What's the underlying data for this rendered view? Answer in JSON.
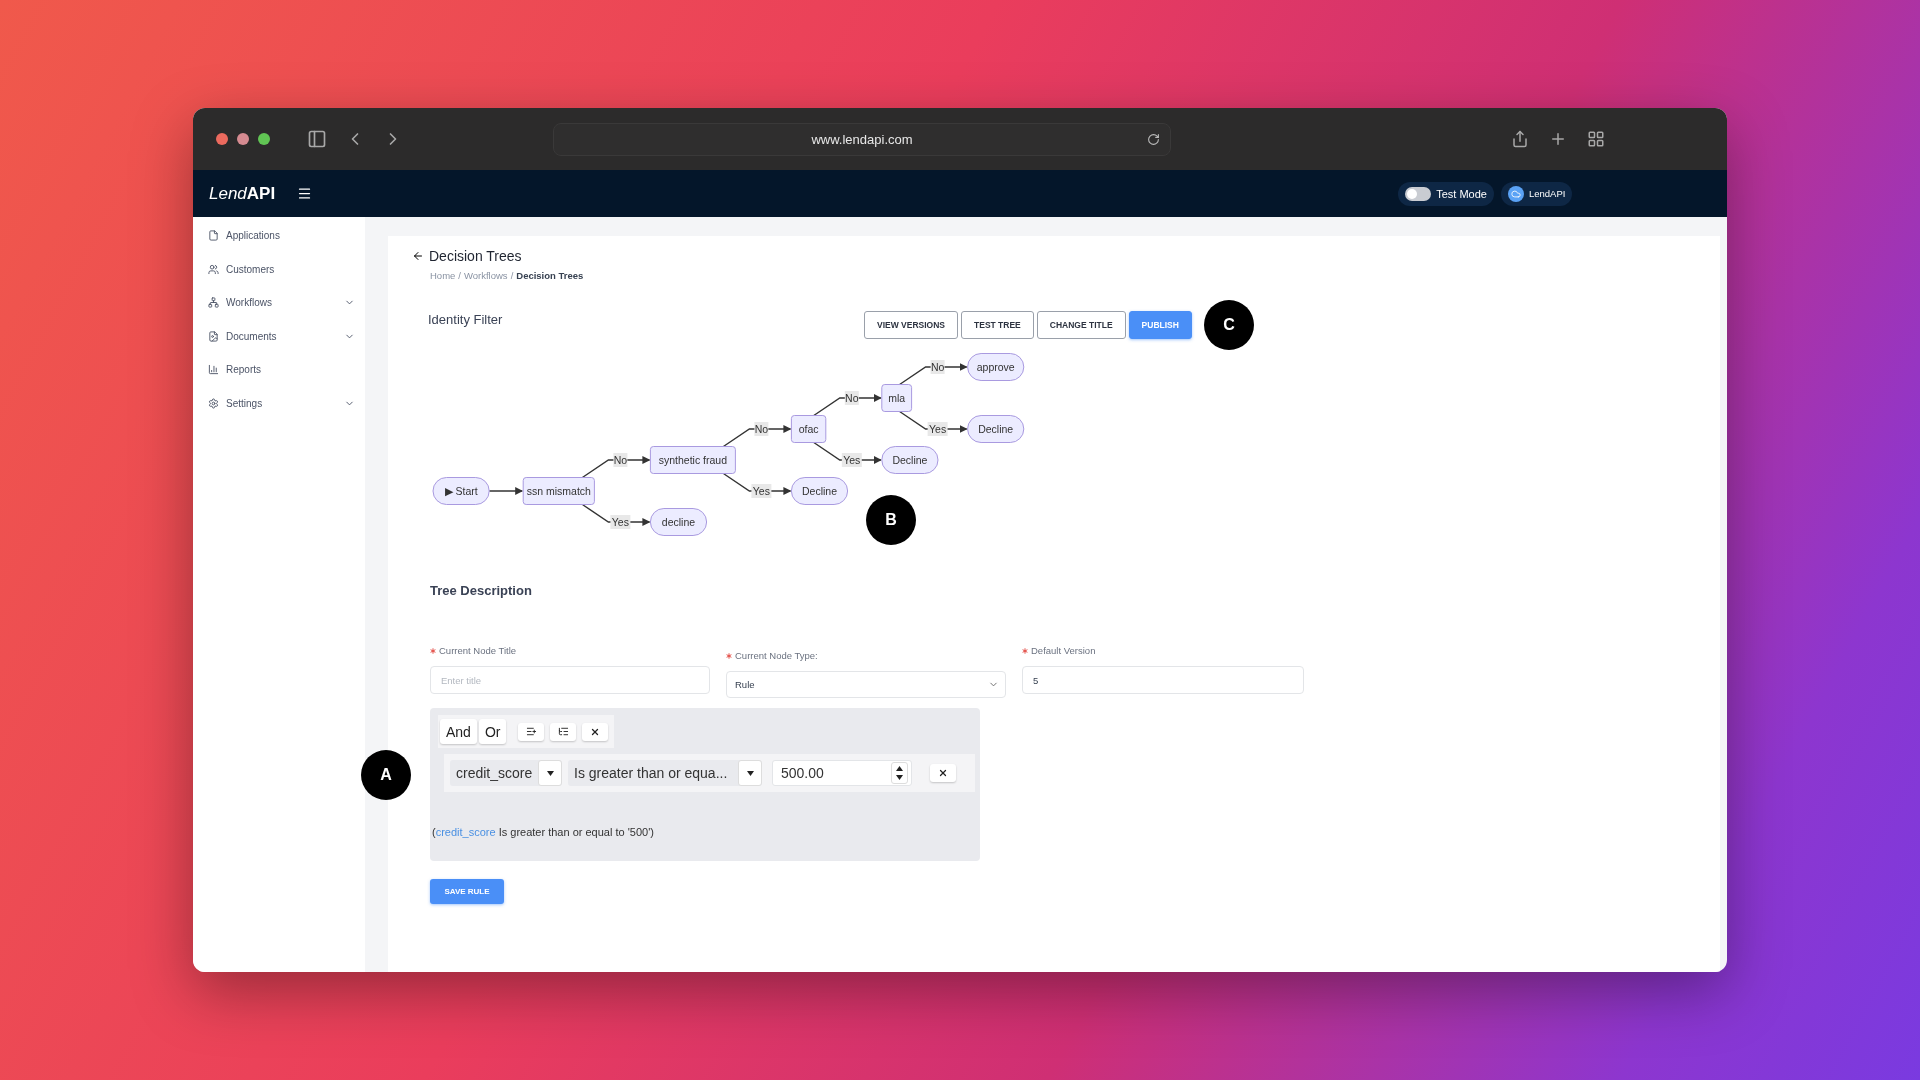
{
  "browser": {
    "url": "www.lendapi.com"
  },
  "app_header": {
    "logo_light": "Lend",
    "logo_bold": "API",
    "test_mode": {
      "label": "Test Mode",
      "on": false
    },
    "user": {
      "name": "LendAPI"
    }
  },
  "sidebar": {
    "items": [
      {
        "label": "Applications",
        "expandable": false
      },
      {
        "label": "Customers",
        "expandable": false
      },
      {
        "label": "Workflows",
        "expandable": true
      },
      {
        "label": "Documents",
        "expandable": true
      },
      {
        "label": "Reports",
        "expandable": false
      },
      {
        "label": "Settings",
        "expandable": true
      }
    ]
  },
  "page": {
    "back_title": "Decision Trees",
    "breadcrumbs": [
      {
        "label": "Home",
        "current": false
      },
      {
        "label": "Workflows",
        "current": false
      },
      {
        "label": "Decision Trees",
        "current": true
      }
    ],
    "breadcrumb_separator": "/",
    "tree_title": "Identity Filter",
    "actions": [
      {
        "label": "VIEW VERSIONS",
        "primary": false
      },
      {
        "label": "TEST TREE",
        "primary": false
      },
      {
        "label": "CHANGE TITLE",
        "primary": false
      },
      {
        "label": "PUBLISH",
        "primary": true
      }
    ],
    "callout": "C"
  },
  "tree": {
    "callout": "B",
    "root": {
      "kind": "start",
      "label": "▶ Start",
      "children": [
        {
          "kind": "decision",
          "label": "ssn mismatch",
          "children": [
            {
              "edge": "No",
              "kind": "decision",
              "label": "synthetic fraud",
              "children": [
                {
                  "edge": "No",
                  "kind": "decision",
                  "label": "ofac",
                  "children": [
                    {
                      "edge": "No",
                      "kind": "decision",
                      "label": "mla",
                      "children": [
                        {
                          "edge": "No",
                          "kind": "outcome",
                          "label": "approve"
                        },
                        {
                          "edge": "Yes",
                          "kind": "outcome",
                          "label": "Decline"
                        }
                      ]
                    },
                    {
                      "edge": "Yes",
                      "kind": "outcome",
                      "label": "Decline"
                    }
                  ]
                },
                {
                  "edge": "Yes",
                  "kind": "outcome",
                  "label": "Decline"
                }
              ]
            },
            {
              "edge": "Yes",
              "kind": "outcome",
              "label": "decline"
            }
          ]
        }
      ]
    }
  },
  "description": {
    "heading": "Tree Description",
    "fields": [
      {
        "kind": "text",
        "label": "Current Node Title",
        "required": true,
        "placeholder": "Enter title"
      },
      {
        "kind": "select",
        "label": "Current Node Type:",
        "required": true,
        "value": "Rule"
      },
      {
        "kind": "text",
        "label": "Default Version",
        "required": true,
        "value": "5"
      }
    ]
  },
  "rule_builder": {
    "callout": "A",
    "combinators": [
      "And",
      "Or"
    ],
    "rule": {
      "field": "credit_score",
      "operator": "Is greater than or equa...",
      "value": "500.00"
    },
    "summary": {
      "open": "(",
      "field": "credit_score",
      "rest": " Is greater than or equal to '500')"
    }
  },
  "save_button": "SAVE RULE"
}
